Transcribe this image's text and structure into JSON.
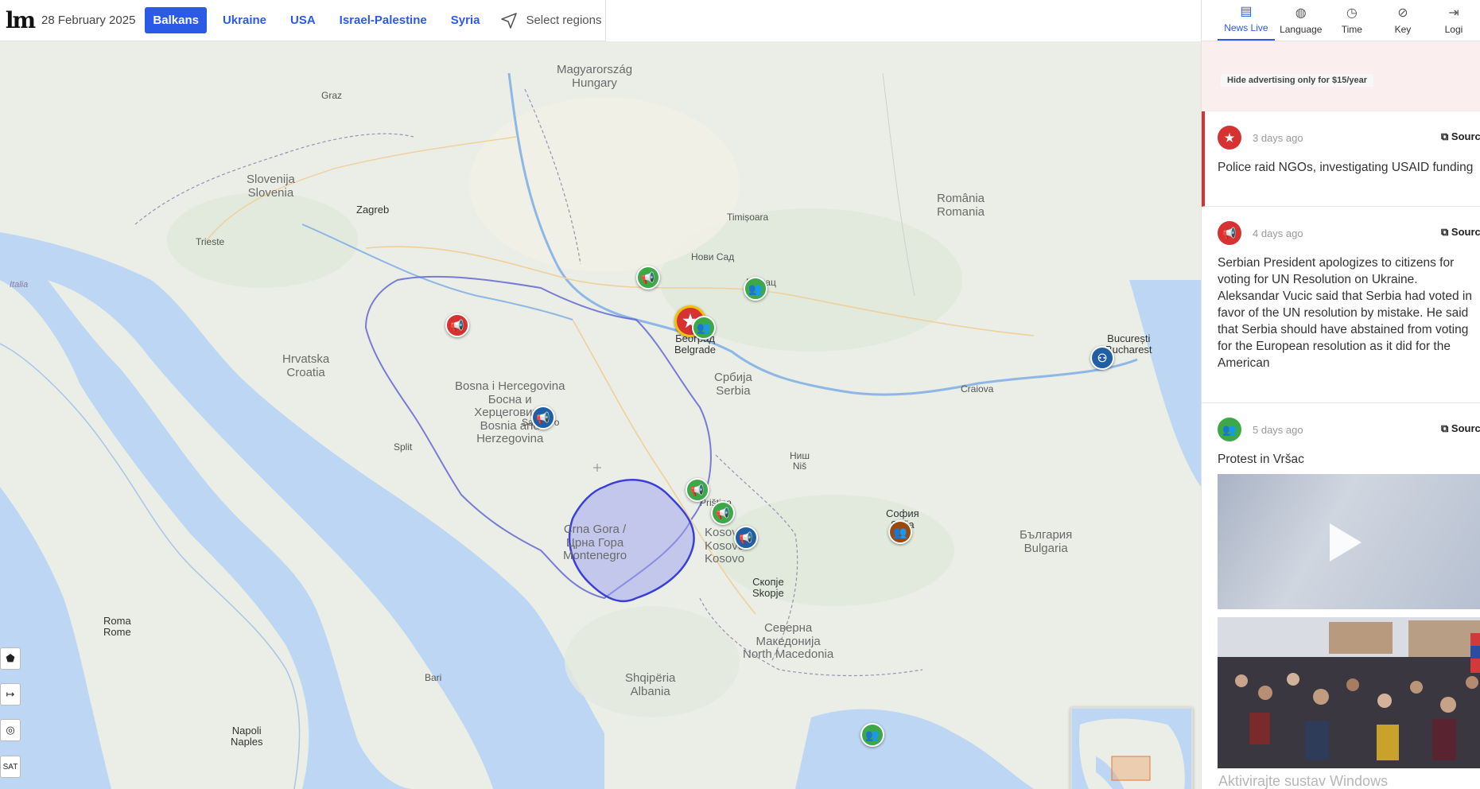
{
  "topbar": {
    "logo": "lm",
    "date": "28 February 2025",
    "tabs": [
      "Balkans",
      "Ukraine",
      "USA",
      "Israel-Palestine",
      "Syria"
    ],
    "active_tab": "Balkans",
    "select_regions": "Select regions"
  },
  "panel_nav": {
    "items": [
      {
        "label": "News Live",
        "icon": "news-icon",
        "active": true
      },
      {
        "label": "Language",
        "icon": "globe-icon"
      },
      {
        "label": "Time",
        "icon": "clock-icon"
      },
      {
        "label": "Key",
        "icon": "compass-icon"
      },
      {
        "label": "Logi",
        "icon": "login-icon"
      }
    ]
  },
  "ad": {
    "label": "Hide advertising only for $15/year"
  },
  "news": [
    {
      "time": "3 days ago",
      "source": "Source",
      "text": "Police raid NGOs, investigating USAID funding",
      "icon": "star-icon",
      "color": "#d63232"
    },
    {
      "time": "4 days ago",
      "source": "Source",
      "text": "Serbian President apologizes to citizens for voting for UN Resolution on Ukraine. Aleksandar Vucic said that Serbia had voted in favor of the UN resolution by mistake. He said that Serbia should have abstained from voting for the European resolution as it did for the American",
      "icon": "megaphone-icon",
      "color": "#d63232"
    },
    {
      "time": "5 days ago",
      "source": "Source",
      "text": "Protest in Vršac",
      "icon": "crowd-icon",
      "color": "#3ca847"
    }
  ],
  "map": {
    "tools": [
      "⬟",
      "↦",
      "◎",
      "SAT"
    ],
    "labels": {
      "magyarorszag": "Magyarország\nHungary",
      "slovenija": "Slovenija\nSlovenia",
      "hrvatska": "Hrvatska\nCroatia",
      "bosna": "Bosna i Hercegovina\nБосна и\nХерцеговина\nBosnia and\nHerzegovina",
      "srbija": "Србија\nSerbia",
      "romania": "România\nRomania",
      "bulgaria": "България\nBulgaria",
      "kosovo": "Kosovo\nKosovo\nKosovo",
      "montenegro": "Crna Gora /\nЦрна Гора\nMontenegro",
      "north_macedonia": "Северна\nМакедонија\nNorth Macedonia",
      "albania": "Shqipëria\nAlbania",
      "italia": "Italia",
      "belgrade": "Београд\nBelgrade",
      "zagreb": "Zagreb",
      "sofia": "София\nSofia",
      "bucuresti": "București\nBucharest",
      "skopje": "Скопје\nSkopje",
      "roma": "Roma\nRome",
      "napoli": "Napoli\nNaples",
      "bari": "Bari",
      "timisoara": "Timișoara",
      "craiova": "Craiova",
      "nis": "Ниш\nNiš",
      "vrsac": "Вршац",
      "novi_sad": "Нови Сад",
      "trieste": "Trieste",
      "sarajevo": "Sarajevo",
      "split": "Split",
      "graz": "Graz",
      "pristina": "Priština"
    }
  },
  "watermark": "Aktivirajte sustav Windows"
}
